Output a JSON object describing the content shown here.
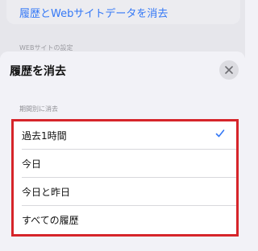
{
  "background": {
    "link_label": "履歴とWebサイトデータを消去",
    "section_label": "WEBサイトの設定"
  },
  "sheet": {
    "title": "履歴を消去",
    "close_icon": "close-icon",
    "section_label": "期間別に消去",
    "options": [
      {
        "label": "過去1時間",
        "selected": true
      },
      {
        "label": "今日",
        "selected": false
      },
      {
        "label": "今日と昨日",
        "selected": false
      },
      {
        "label": "すべての履歴",
        "selected": false
      }
    ]
  },
  "colors": {
    "accent": "#3478f6",
    "highlight_border": "#d6252a"
  }
}
